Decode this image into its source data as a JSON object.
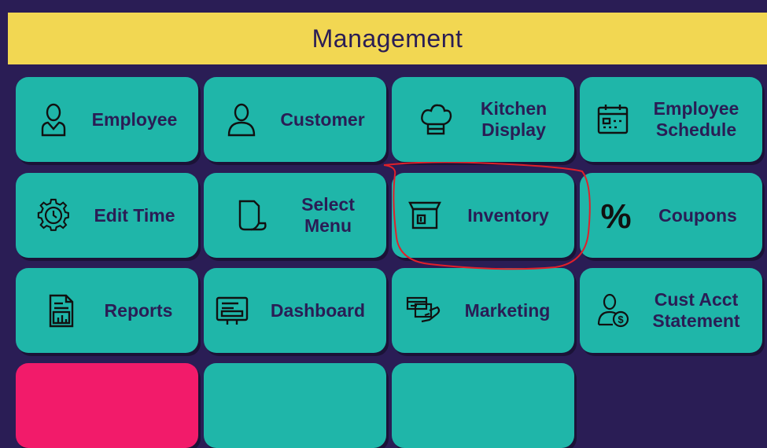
{
  "header": {
    "title": "Management"
  },
  "tiles": {
    "employee": {
      "label": "Employee",
      "icon": "person-icon"
    },
    "customer": {
      "label": "Customer",
      "icon": "user-outline-icon"
    },
    "kitchen_display": {
      "label": "Kitchen\nDisplay",
      "icon": "chef-hat-icon"
    },
    "employee_schedule": {
      "label": "Employee\nSchedule",
      "icon": "calendar-icon"
    },
    "edit_time": {
      "label": "Edit Time",
      "icon": "gear-clock-icon"
    },
    "select_menu": {
      "label": "Select\nMenu",
      "icon": "document-icon"
    },
    "inventory": {
      "label": "Inventory",
      "icon": "box-icon"
    },
    "coupons": {
      "label": "Coupons",
      "icon": "percent-icon"
    },
    "reports": {
      "label": "Reports",
      "icon": "report-icon"
    },
    "dashboard": {
      "label": "Dashboard",
      "icon": "dashboard-icon"
    },
    "marketing": {
      "label": "Marketing",
      "icon": "card-hand-icon"
    },
    "cust_acct": {
      "label": "Cust Acct\nStatement",
      "icon": "person-dollar-icon"
    }
  },
  "colors": {
    "background": "#2a1d55",
    "header": "#f2d752",
    "tile": "#1fb6a9",
    "text": "#2a1d55",
    "alert_tile": "#f21b6a",
    "annotation": "#e0202a"
  }
}
